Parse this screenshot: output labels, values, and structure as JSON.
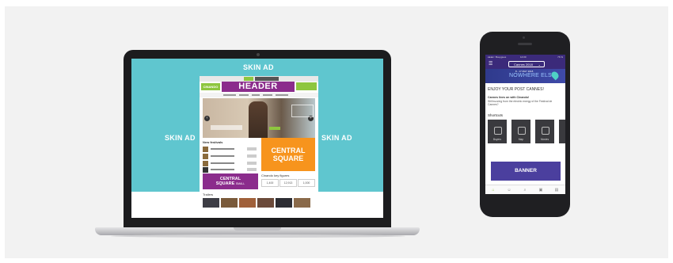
{
  "laptop": {
    "skin_ad_top": "SKIN AD",
    "skin_ad_left": "SKIN AD",
    "skin_ad_right": "SKIN AD",
    "site": {
      "logo": "CINANDO",
      "header": "HEADER",
      "new_festivals": "New festivals",
      "central_square_line1": "CENTRAL",
      "central_square_line2": "SQUARE",
      "central_square_small_line1": "CENTRAL",
      "central_square_small_line2": "SQUARE",
      "central_square_small_suffix": "SMALL",
      "figures_title": "Cinando key figures",
      "figures": [
        "1,400",
        "12,913",
        "1,000"
      ],
      "trailers_title": "Trailers"
    }
  },
  "phone": {
    "status_left": "●●●●○ Bouygues",
    "status_center": "14:00",
    "status_right": "76 %",
    "menu_icon": "hamburger-icon",
    "select_value": "Cannes 2018",
    "banner_date": "8 - 17 MAY 2018",
    "banner_title": "NOWHERE ELSE",
    "enjoy_text": "ENJOY YOUR POST CANNES!",
    "cannes_title": "Cannes lives on with Cinando!",
    "cannes_body": "Still buzzing from the electric energy of the Festival de Cannes?",
    "shortcuts_title": "Shortcuts",
    "shortcuts": [
      "Buyers",
      "Map",
      "Movies",
      ""
    ],
    "banner_ad": "BANNER",
    "tabs": [
      "home-icon",
      "people-icon",
      "search-icon",
      "film-icon",
      "calendar-icon"
    ]
  },
  "colors": {
    "skin_background": "#5fc6cf",
    "header_purple": "#8b2c8c",
    "central_square_orange": "#f7941d",
    "phone_purple": "#3b2a7a",
    "banner_purple": "#4b3f9e",
    "accent_green": "#8ec63f"
  }
}
